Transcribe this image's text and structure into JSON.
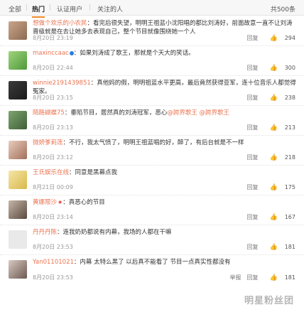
{
  "tabs": {
    "all": "全部",
    "hot": "热门",
    "verified": "认证用户",
    "following": "关注的人",
    "total": "共500条"
  },
  "colors": {
    "username": "#eb7350",
    "accent": "#f08a24"
  },
  "comments": [
    {
      "user": "想做个欢乐的小农民",
      "text": "：看完后很失望，明明王祖蓝小沈阳唱的都比刘涛好，前面故意一直不让刘涛晋级就是在去让她多去表现自己，整个节目就像围绕她一个人",
      "time": "8月20日 23:19",
      "reply": "回复",
      "likes": "294"
    },
    {
      "user": "maxinccaac",
      "text": "：如果刘涛成了歌王，那就是个天大的笑话。",
      "time": "8月20日 22:44",
      "reply": "回复",
      "likes": "300"
    },
    {
      "user": "winnie2191439851",
      "text": "：真他妈的假，明明祖蓝水平更高，最后竟然获得亚军，连十位音乐人都觉得冤家。",
      "time": "8月20日 23:15",
      "reply": "回复",
      "likes": "238"
    },
    {
      "user": "陌路蝴蝶75",
      "text": "：垂陷节目，居然真的刘涛冠军，恶心",
      "mention": "@跨界歌王 @跨界歌王",
      "time": "8月20日 23:13",
      "reply": "回复",
      "likes": "213"
    },
    {
      "user": "微娇爹莉莲",
      "text": "：不行，我太气愤了，明明王祖蓝唱的好，醉了，有后台就是不一样",
      "time": "8月20日 23:12",
      "reply": "回复",
      "likes": "218"
    },
    {
      "user": "王氏娱乐在线",
      "text": "：同意是黑幕点我",
      "time": "8月21日 00:09",
      "reply": "回复",
      "likes": "175"
    },
    {
      "user": "黄娜限沙",
      "text": "：真恶心的节目",
      "time": "8月20日 23:14",
      "reply": "回复",
      "likes": "167"
    },
    {
      "user": "丹丹丹陈",
      "text": "：连我奶奶都说有内幕，我场的人都在干嘛",
      "time": "8月20日 23:53",
      "reply": "回复",
      "likes": "181"
    },
    {
      "user": "Yan01101021",
      "text": "：内幕  太特么黑了  以后真不能看了  节目一点真实性都没有",
      "time": "8月20日 23:53",
      "report": "举报",
      "reply": "回复",
      "likes": "181"
    }
  ],
  "watermark": "明星粉丝团"
}
